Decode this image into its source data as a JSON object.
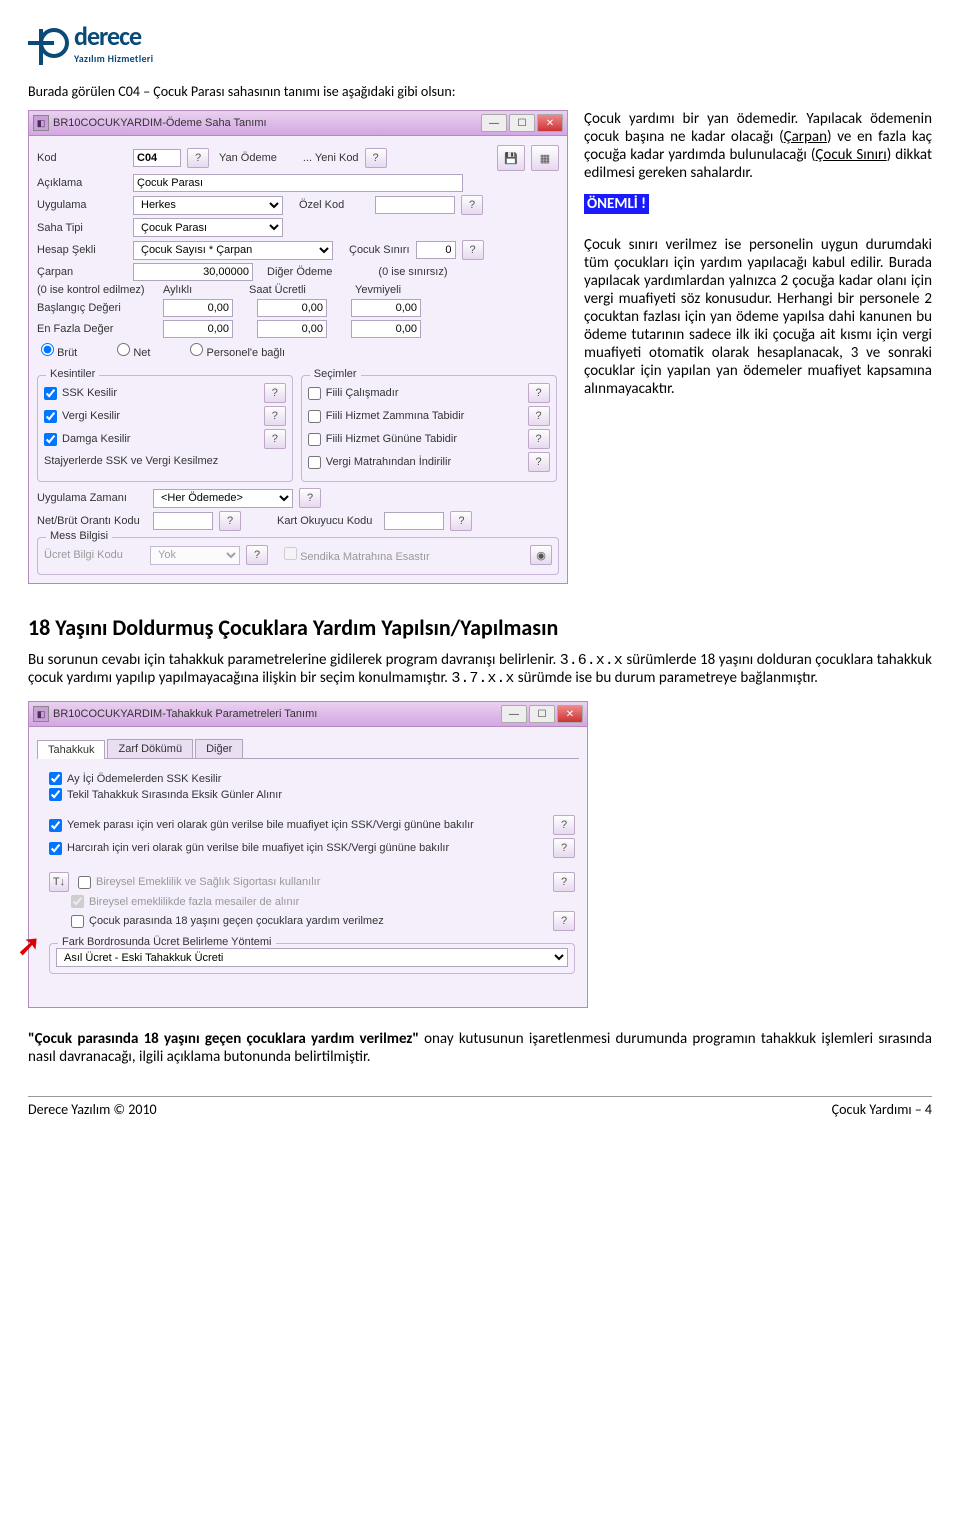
{
  "logo": {
    "brand": "derece",
    "sub": "Yazılım Hizmetleri"
  },
  "intro": "Burada görülen C04 – Çocuk Parası sahasının tanımı ise aşağıdaki gibi olsun:",
  "win1": {
    "title": "BR10COCUKYARDIM-Ödeme Saha Tanımı",
    "labels": {
      "kod": "Kod",
      "yan_odeme": "Yan Ödeme",
      "yeni_kod": "... Yeni Kod",
      "aciklama": "Açıklama",
      "uygulama": "Uygulama",
      "ozel_kod": "Özel Kod",
      "saha_tipi": "Saha Tipi",
      "hesap_sekli": "Hesap Şekli",
      "cocuk_siniri": "Çocuk Sınırı",
      "carpan": "Çarpan",
      "diger_odeme": "Diğer Ödeme",
      "sinirsiz": "(0 ise sınırsız)",
      "kontrol": "(0 ise kontrol edilmez)",
      "aylikli": "Aylıklı",
      "saat_ucretli": "Saat Ücretli",
      "yevmiyeli": "Yevmiyeli",
      "baslangic": "Başlangıç Değeri",
      "enfazla": "En Fazla Değer",
      "brut": "Brüt",
      "net": "Net",
      "personele": "Personel'e bağlı",
      "kesintiler": "Kesintiler",
      "secimler": "Seçimler",
      "ssk": "SSK Kesilir",
      "vergi": "Vergi Kesilir",
      "damga": "Damga Kesilir",
      "stajyer": "Stajyerlerde SSK ve Vergi Kesilmez",
      "fiili_cal": "Fiili Çalışmadır",
      "fiili_zam": "Fiili Hizmet Zammına Tabidir",
      "fiili_gun": "Fiili Hizmet Gününe Tabidir",
      "vergi_mat": "Vergi Matrahından İndirilir",
      "uyg_zamani": "Uygulama Zamanı",
      "net_brut": "Net/Brüt Orantı Kodu",
      "kart": "Kart Okuyucu Kodu",
      "mess": "Mess Bilgisi",
      "ucret_bilgi": "Ücret Bilgi Kodu",
      "sendika": "Sendika Matrahına Esastır"
    },
    "values": {
      "kod": "C04",
      "aciklama": "Çocuk Parası",
      "uygulama": "Herkes",
      "ozel_kod": "",
      "saha_tipi": "Çocuk Parası",
      "hesap_sekli": "Çocuk Sayısı * Çarpan",
      "cocuk_siniri": "0",
      "carpan": "30,00000",
      "d1": "0,00",
      "d2": "0,00",
      "d3": "0,00",
      "e1": "0,00",
      "e2": "0,00",
      "e3": "0,00",
      "uyg_zamani": "<Her Ödemede>",
      "ucret_bilgi": "Yok"
    }
  },
  "right": {
    "p1a": "Çocuk yardımı bir yan ödemedir. Yapılacak ödemenin çocuk başına ne kadar olacağı (",
    "p1b": ") ve en fazla kaç çocuğa kadar yardımda bulunulacağı (",
    "p1c": ") dikkat edilmesi gereken sahalardır.",
    "carpan": "Çarpan",
    "siniri": "Çocuk Sınırı",
    "onemli": "ÖNEMLİ !",
    "p2": "Çocuk sınırı verilmez ise personelin uygun durumdaki tüm çocukları için yardım yapılacağı kabul edilir. Burada yapılacak yardımlardan yalnızca 2 çocuğa kadar olanı için vergi muafiyeti söz konusudur. Herhangi bir personele 2 çocuktan fazlası için yan ödeme yapılsa dahi kanunen bu ödeme tutarının sadece ilk iki çocuğa ait kısmı için vergi muafiyeti otomatik olarak hesaplanacak, 3 ve sonraki çocuklar için yapılan yan ödemeler muafiyet kapsamına alınmayacaktır."
  },
  "section2": {
    "heading": "18 Yaşını Doldurmuş Çocuklara Yardım Yapılsın/Yapılmasın",
    "p_a": "Bu sorunun cevabı için tahakkuk parametrelerine gidilerek program davranışı belirlenir. ",
    "v1": "3.6.x.x",
    "p_b": " sürümlerde 18 yaşını dolduran çocuklara tahakkuk çocuk yardımı yapılıp yapılmayacağına ilişkin bir seçim konulmamıştır. ",
    "v2": "3.7.x.x",
    "p_c": " sürümde ise bu durum parametreye bağlanmıştır."
  },
  "win2": {
    "title": "BR10COCUKYARDIM-Tahakkuk Parametreleri Tanımı",
    "tabs": {
      "t1": "Tahakkuk",
      "t2": "Zarf Dökümü",
      "t3": "Diğer"
    },
    "c1": "Ay İçi Ödemelerden SSK Kesilir",
    "c2": "Tekil Tahakkuk Sırasında Eksik Günler Alınır",
    "c3": "Yemek parası için veri olarak gün verilse bile muafiyet için SSK/Vergi gününe bakılır",
    "c4": "Harcırah için veri olarak gün verilse bile muafiyet için SSK/Vergi gününe bakılır",
    "c5": "Bireysel Emeklilik ve Sağlık Sigortası kullanılır",
    "c6": "Bireysel emeklilikde fazla mesailer de alınır",
    "c7": "Çocuk parasında 18 yaşını geçen çocuklara yardım verilmez",
    "fs": "Fark Bordrosunda Ücret Belirleme Yöntemi",
    "fs_val": "Asıl Ücret - Eski Tahakkuk Ücreti"
  },
  "closing_a": "\"Çocuk parasında 18 yaşını geçen çocuklara yardım verilmez\"",
  "closing_b": " onay kutusunun işaretlenmesi durumunda programın tahakkuk işlemleri sırasında nasıl davranacağı, ilgili açıklama butonunda belirtilmiştir.",
  "footer": {
    "left": "Derece Yazılım © 2010",
    "right": "Çocuk Yardımı – 4"
  }
}
